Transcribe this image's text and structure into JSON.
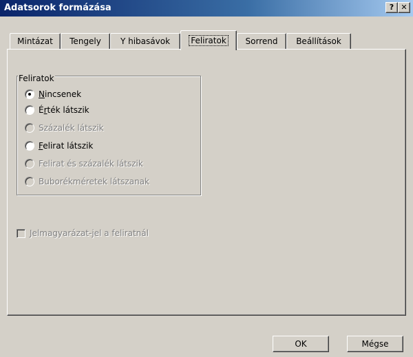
{
  "window": {
    "title": "Adatsorok formázása",
    "help_label": "?",
    "close_label": "✕"
  },
  "tabs": [
    {
      "label": "Mintázat",
      "active": false
    },
    {
      "label": "Tengely",
      "active": false
    },
    {
      "label": "Y hibasávok",
      "active": false
    },
    {
      "label": "Feliratok",
      "active": true
    },
    {
      "label": "Sorrend",
      "active": false
    },
    {
      "label": "Beállítások",
      "active": false
    }
  ],
  "labels_group": {
    "legend": "Feliratok",
    "options": [
      {
        "pre": "",
        "accel": "N",
        "post": "incsenek",
        "checked": true,
        "enabled": true
      },
      {
        "pre": "É",
        "accel": "r",
        "post": "ték látszik",
        "checked": false,
        "enabled": true
      },
      {
        "pre": "",
        "accel": "",
        "post": "Százalék látszik",
        "checked": false,
        "enabled": false
      },
      {
        "pre": "",
        "accel": "F",
        "post": "elirat látszik",
        "checked": false,
        "enabled": true
      },
      {
        "pre": "",
        "accel": "",
        "post": "Felirat és százalék látszik",
        "checked": false,
        "enabled": false
      },
      {
        "pre": "",
        "accel": "",
        "post": "Buborékméretek látszanak",
        "checked": false,
        "enabled": false
      }
    ]
  },
  "legend_key_checkbox": {
    "label": "Jelmagyarázat-jel a feliratnál",
    "checked": false,
    "enabled": false
  },
  "buttons": {
    "ok": "OK",
    "cancel": "Mégse"
  }
}
